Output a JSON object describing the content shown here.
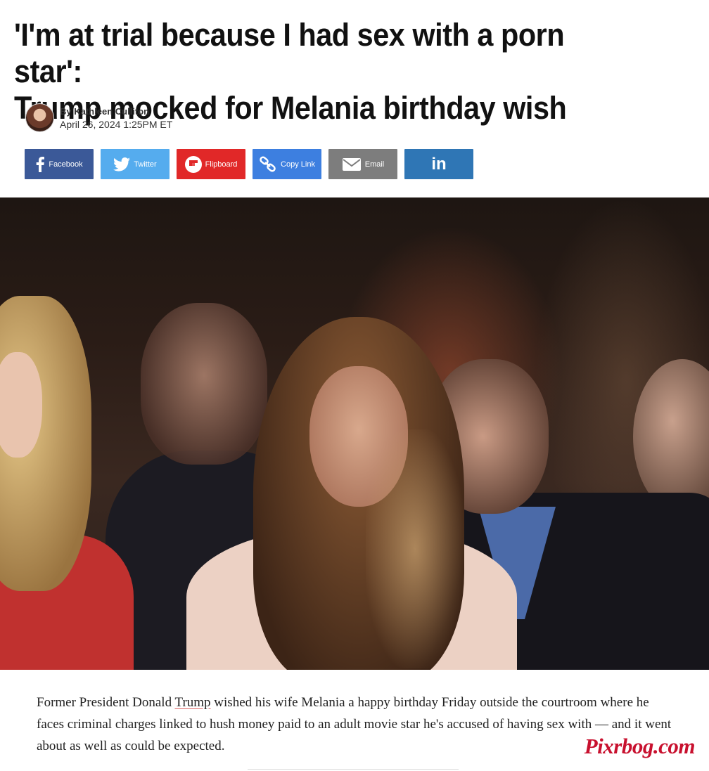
{
  "article": {
    "headline_line1": "'I'm at trial because I had sex with a porn star':",
    "headline_line2": "Trump mocked for Melania birthday wish",
    "author": "By Kathleen Culliton",
    "date": "April 26, 2024 1:25PM ET",
    "lede_before": "Former President Donald ",
    "lede_link": "Trump",
    "lede_after": " wished his wife Melania a happy birthday Friday outside the courtroom where he faces criminal charges linked to hush money paid to an adult movie star he's accused of having sex with — and it went about as well as could be expected."
  },
  "share": {
    "facebook": {
      "label": "Facebook",
      "icon": "facebook-icon",
      "color": "#3b5998"
    },
    "twitter": {
      "label": "Twitter",
      "icon": "twitter-icon",
      "color": "#55acee"
    },
    "flipboard": {
      "label": "Flipboard",
      "icon": "flipboard-icon",
      "color": "#e12828"
    },
    "copylink": {
      "label": "Copy Link",
      "icon": "link-icon",
      "color": "#3d7fe0"
    },
    "email": {
      "label": "Email",
      "icon": "envelope-icon",
      "color": "#7d7d7d"
    },
    "linkedin": {
      "label": "in",
      "icon": "linkedin-icon",
      "color": "#2f76b5"
    }
  },
  "watermark": "Pixrbog.com"
}
